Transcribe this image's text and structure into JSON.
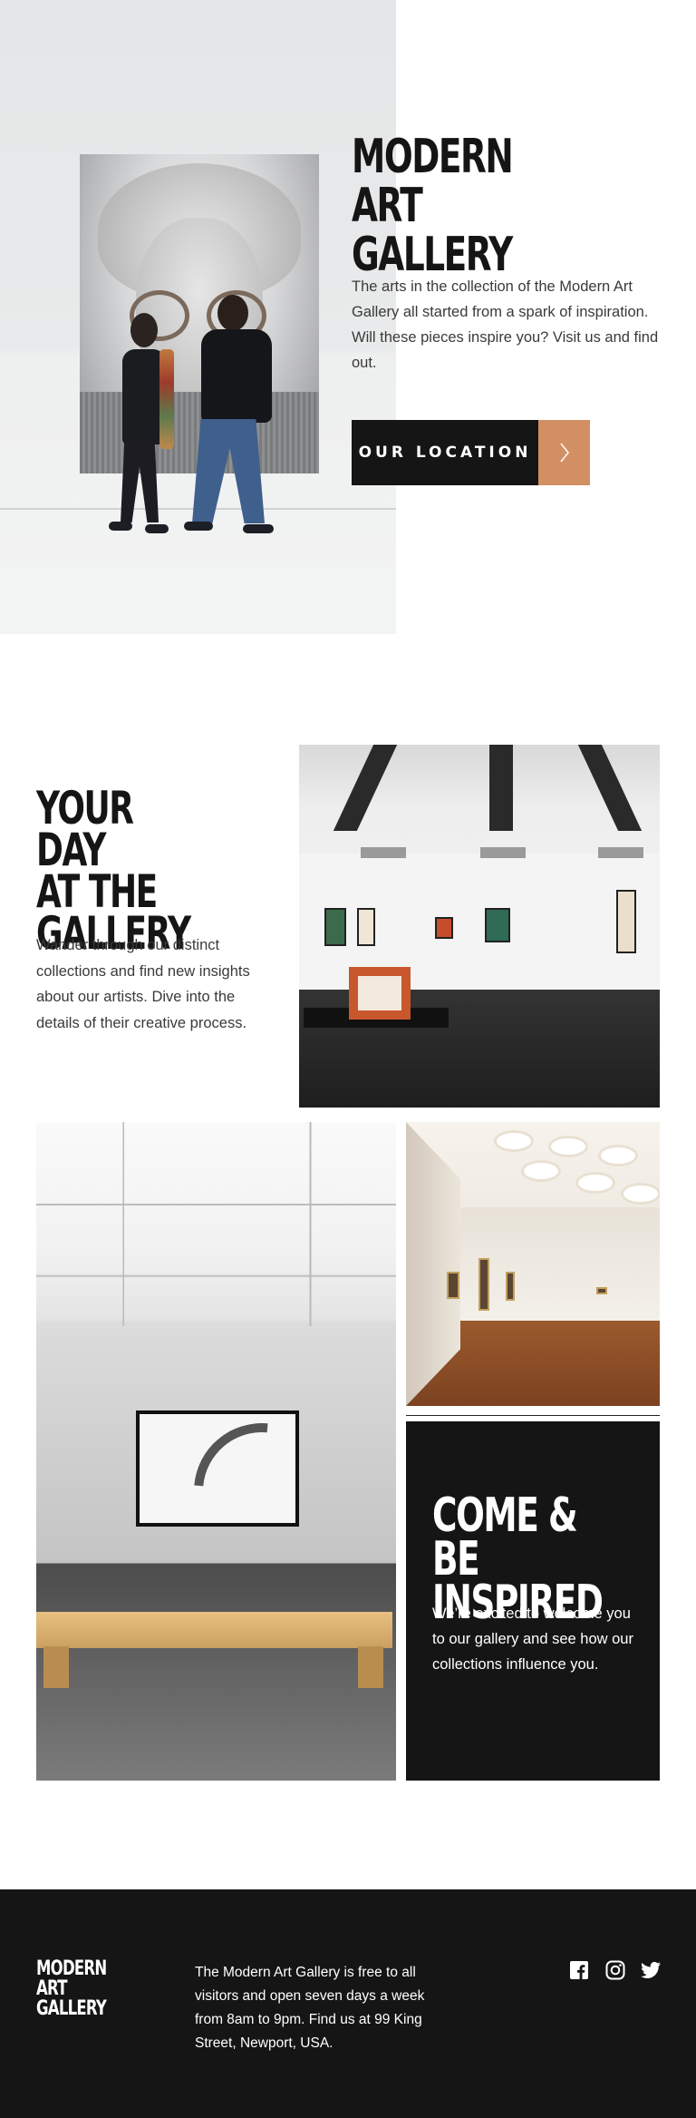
{
  "hero": {
    "title": "MODERN\nART GALLERY",
    "description": "The arts in the collection of the Modern Art Gallery all started from a spark of inspiration. Will these pieces inspire you? Visit us and find out.",
    "cta_label": "OUR LOCATION",
    "cta_icon": "chevron-right-icon",
    "image": "visitors-viewing-portrait-photo"
  },
  "day": {
    "title": "YOUR DAY\nAT THE\nGALLERY",
    "description": "Wander through our distinct collections and find new insights about our artists. Dive into the details of their creative process.",
    "images": [
      "gallery-room-photo",
      "bench-gallery-photo",
      "hallway-gallery-photo"
    ]
  },
  "inspire": {
    "title": "COME & BE\nINSPIRED",
    "description": "We’re excited to welcome you to our gallery and see how our collections influence you."
  },
  "footer": {
    "logo": "MODERN\nART GALLERY",
    "info": "The Modern Art Gallery is free to all visitors and open seven days a week from 8am to 9pm. Find us at 99 King Street, Newport, USA.",
    "social": [
      "facebook-icon",
      "instagram-icon",
      "twitter-icon"
    ]
  },
  "colors": {
    "dark": "#151515",
    "accent": "#d38f64",
    "text_gray": "#3a3a3a",
    "white": "#ffffff"
  }
}
